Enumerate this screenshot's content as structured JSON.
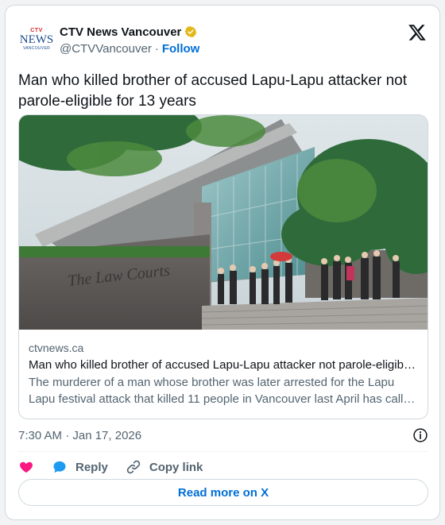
{
  "account": {
    "logo": {
      "top": "CTV",
      "main": "NEWS",
      "sub": "VANCOUVER"
    },
    "display_name": "CTV News Vancouver",
    "handle": "@CTVVancouver",
    "separator": "·",
    "follow_label": "Follow",
    "verified_icon": "gold-verified-badge-icon",
    "brand_icon": "x-logo-icon"
  },
  "tweet": {
    "text": "Man who killed brother of accused Lapu-Lapu attacker not parole-eligible for 13 years"
  },
  "link_card": {
    "image_alt": "People gathered on the steps outside the Law Courts building",
    "sign_text": "The Law Courts",
    "domain": "ctvnews.ca",
    "title": "Man who killed brother of accused Lapu-Lapu attacker not parole-eligib…",
    "description": "The murderer of a man whose brother was later arrested for the Lapu Lapu festival attack that killed 11 people in Vancouver last April has call…"
  },
  "meta": {
    "timestamp": "7:30 AM · Jan 17, 2026"
  },
  "actions": {
    "like_icon": "heart-icon",
    "reply_label": "Reply",
    "copy_label": "Copy link"
  },
  "cta": {
    "read_more_label": "Read more on X"
  },
  "colors": {
    "accent": "#006fd6",
    "heart": "#f91880",
    "border": "#cfd9de",
    "muted": "#536471"
  }
}
